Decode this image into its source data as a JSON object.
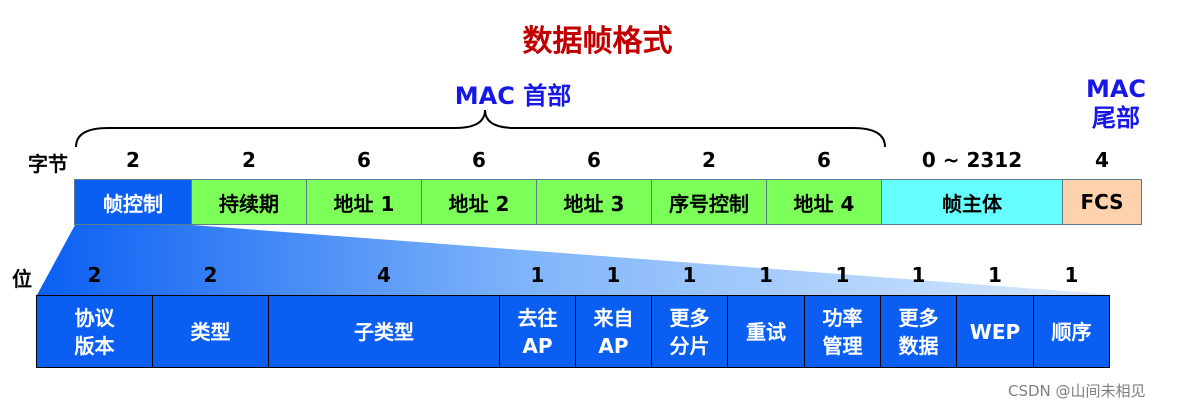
{
  "title": "数据帧格式",
  "mac_header_label": "MAC 首部",
  "mac_trailer_label": "MAC\n尾部",
  "byte_label": "字节",
  "bit_label": "位",
  "frame_fields": [
    {
      "label": "帧控制",
      "bytes": "2",
      "color": "#0a5ff2",
      "text_color": "#ffffff"
    },
    {
      "label": "持续期",
      "bytes": "2",
      "color": "#7dff5a",
      "text_color": "#000000"
    },
    {
      "label": "地址 1",
      "bytes": "6",
      "color": "#7dff5a",
      "text_color": "#000000"
    },
    {
      "label": "地址 2",
      "bytes": "6",
      "color": "#7dff5a",
      "text_color": "#000000"
    },
    {
      "label": "地址 3",
      "bytes": "6",
      "color": "#7dff5a",
      "text_color": "#000000"
    },
    {
      "label": "序号控制",
      "bytes": "2",
      "color": "#7dff5a",
      "text_color": "#000000"
    },
    {
      "label": "地址 4",
      "bytes": "6",
      "color": "#7dff5a",
      "text_color": "#000000"
    },
    {
      "label": "帧主体",
      "bytes": "0 ~ 2312",
      "color": "#66ffff",
      "text_color": "#000000"
    },
    {
      "label": "FCS",
      "bytes": "4",
      "color": "#ffd2ae",
      "text_color": "#000000"
    }
  ],
  "control_fields": [
    {
      "label": "协议\n版本",
      "bits": "2"
    },
    {
      "label": "类型",
      "bits": "2"
    },
    {
      "label": "子类型",
      "bits": "4"
    },
    {
      "label": "去往\nAP",
      "bits": "1"
    },
    {
      "label": "来自\nAP",
      "bits": "1"
    },
    {
      "label": "更多\n分片",
      "bits": "1"
    },
    {
      "label": "重试",
      "bits": "1"
    },
    {
      "label": "功率\n管理",
      "bits": "1"
    },
    {
      "label": "更多\n数据",
      "bits": "1"
    },
    {
      "label": "WEP",
      "bits": "1"
    },
    {
      "label": "顺序",
      "bits": "1"
    }
  ],
  "watermark": "CSDN @山间未相见",
  "colors": {
    "title": "#c00000",
    "header": "#1717e6",
    "control_blue": "#0a5ff2",
    "wedge_light": "#cfe6ff"
  }
}
